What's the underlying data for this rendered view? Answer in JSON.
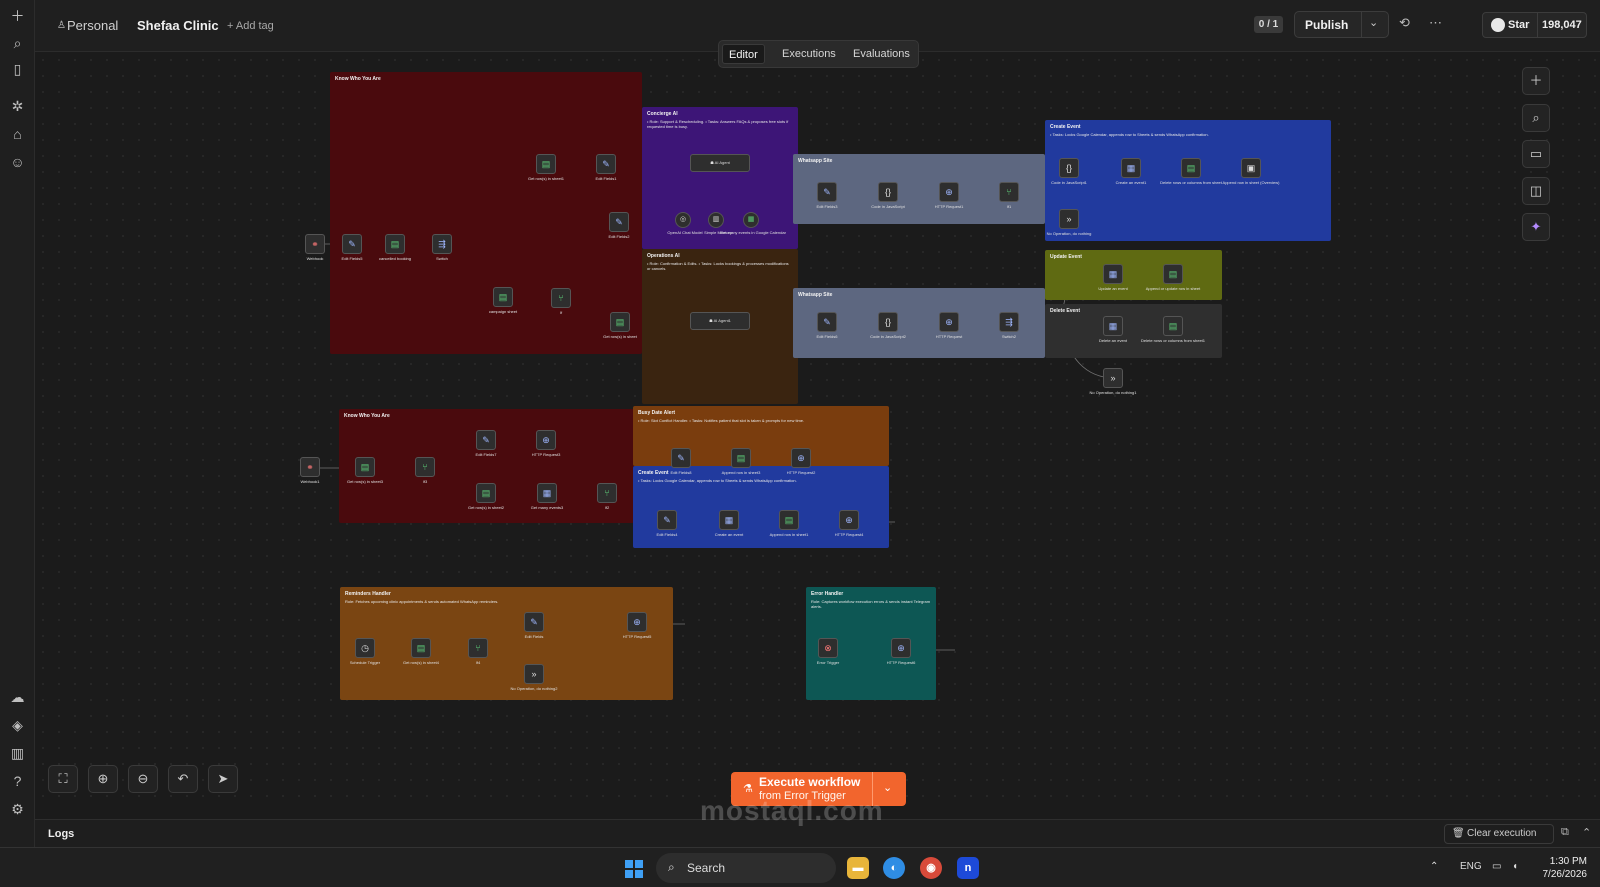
{
  "header": {
    "owner": "Personal",
    "workflow_name": "Shefaa Clinic",
    "add_tag": "+ Add tag",
    "version_counter": "0 / 1",
    "publish_label": "Publish",
    "star_label": "Star",
    "star_count": "198,047"
  },
  "tabs": [
    {
      "label": "Editor",
      "active": true
    },
    {
      "label": "Executions",
      "active": false
    },
    {
      "label": "Evaluations",
      "active": false
    }
  ],
  "sidebar_icons": [
    "plus-icon",
    "search-icon",
    "panel-icon",
    "templates-icon",
    "home-icon",
    "user-icon",
    "cloud-icon",
    "layers-icon",
    "chart-icon",
    "help-icon",
    "settings-icon"
  ],
  "stickies": [
    {
      "id": "know1",
      "title": "Know Who You Are",
      "text": "",
      "color": "#4a0a0d"
    },
    {
      "id": "concierge",
      "title": "Concierge AI",
      "text": "• Role: Support & Rescheduling. • Tasks: Answers FAQs & proposes free slots if requested time is busy.",
      "color": "#3d1577"
    },
    {
      "id": "operations",
      "title": "Operations AI",
      "text": "• Role: Confirmation & Edits. • Tasks: Locks bookings & processes modifications or cancels.",
      "color": "#3a2410"
    },
    {
      "id": "whatsapp1",
      "title": "Whatsapp Site",
      "text": "",
      "color": "#5d6780"
    },
    {
      "id": "whatsapp2",
      "title": "Whatsapp Site",
      "text": "",
      "color": "#5d6780"
    },
    {
      "id": "create1",
      "title": "Create Event",
      "text": "• Tasks: Locks Google Calendar, appends row to Sheets & sends WhatsApp confirmation.",
      "color": "#213a9e"
    },
    {
      "id": "update",
      "title": "Update Event",
      "text": "",
      "color": "#5f6a12"
    },
    {
      "id": "delete",
      "title": "Delete Event",
      "text": "",
      "color": "#2f2f2f"
    },
    {
      "id": "know2",
      "title": "Know Who You Are",
      "text": "",
      "color": "#4a0a0d"
    },
    {
      "id": "busy",
      "title": "Busy Date Alert",
      "text": "• Role: Slot Conflict Handler. • Tasks: Notifies patient that slot is taken & prompts for new time.",
      "color": "#7a3d0e"
    },
    {
      "id": "create2",
      "title": "Create Event",
      "text": "• Tasks: Locks Google Calendar, appends row to Sheets & sends WhatsApp confirmation.",
      "color": "#213a9e"
    },
    {
      "id": "reminders",
      "title": "Reminders Handler",
      "text": "Role: Fetches upcoming clinic appointments & sends automated WhatsApp reminders.",
      "color": "#7a4512"
    },
    {
      "id": "error",
      "title": "Error Handler",
      "text": "Role: Captures workflow execution errors & sends instant Telegram alerts.",
      "color": "#0d5754"
    }
  ],
  "nodes": [
    {
      "label": "Webhook",
      "icon": "webhook-icon",
      "kind": "r"
    },
    {
      "label": "Edit Fields5",
      "icon": "edit-icon",
      "kind": "b"
    },
    {
      "label": "cancelled booking",
      "icon": "sheet-icon",
      "kind": "g"
    },
    {
      "label": "Switch",
      "icon": "switch-icon",
      "kind": "b"
    },
    {
      "label": "Get row(s) in sheet1",
      "icon": "sheet-icon",
      "kind": "g"
    },
    {
      "label": "Edit Fields1",
      "icon": "edit-icon",
      "kind": "b"
    },
    {
      "label": "Edit Fields2",
      "icon": "edit-icon",
      "kind": "b"
    },
    {
      "label": "campaign sheet",
      "icon": "sheet-icon",
      "kind": "g"
    },
    {
      "label": "If",
      "icon": "if-icon",
      "kind": "g"
    },
    {
      "label": "Get row(s) in sheet",
      "icon": "sheet-icon",
      "kind": "g"
    },
    {
      "label": "AI Agent",
      "icon": "agent-icon",
      "kind": ""
    },
    {
      "label": "OpenAI Chat Model",
      "icon": "openai-icon",
      "kind": ""
    },
    {
      "label": "Simple Memory",
      "icon": "memory-icon",
      "kind": ""
    },
    {
      "label": "Get many events in Google Calendar",
      "icon": "calendar-icon",
      "kind": "g"
    },
    {
      "label": "AI Agent1",
      "icon": "agent-icon",
      "kind": ""
    },
    {
      "label": "Edit Fields3",
      "icon": "edit-icon",
      "kind": "b"
    },
    {
      "label": "Code in JavaScript",
      "icon": "code-icon",
      "kind": ""
    },
    {
      "label": "HTTP Request1",
      "icon": "http-icon",
      "kind": "b"
    },
    {
      "label": "If1",
      "icon": "if-icon",
      "kind": "g"
    },
    {
      "label": "Code in JavaScript1",
      "icon": "code-icon",
      "kind": ""
    },
    {
      "label": "Create an event1",
      "icon": "calendar-icon",
      "kind": "b"
    },
    {
      "label": "Delete rows or columns from sheet",
      "icon": "sheet-icon",
      "kind": "g"
    },
    {
      "label": "Append row in sheet (Overview)",
      "icon": "doc-icon",
      "kind": ""
    },
    {
      "label": "No Operation, do nothing",
      "icon": "noop-icon",
      "kind": ""
    },
    {
      "label": "Edit Fields6",
      "icon": "edit-icon",
      "kind": "b"
    },
    {
      "label": "Code in JavaScript2",
      "icon": "code-icon",
      "kind": ""
    },
    {
      "label": "HTTP Request",
      "icon": "http-icon",
      "kind": "b"
    },
    {
      "label": "Switch2",
      "icon": "switch-icon",
      "kind": "b"
    },
    {
      "label": "Update an event",
      "icon": "calendar-icon",
      "kind": "b"
    },
    {
      "label": "Append or update row in sheet",
      "icon": "sheet-icon",
      "kind": "g"
    },
    {
      "label": "Delete an event",
      "icon": "calendar-icon",
      "kind": "b"
    },
    {
      "label": "Delete rows or columns from sheet1",
      "icon": "sheet-icon",
      "kind": "g"
    },
    {
      "label": "No Operation, do nothing1",
      "icon": "noop-icon",
      "kind": ""
    },
    {
      "label": "Webhook1",
      "icon": "webhook-icon",
      "kind": "r"
    },
    {
      "label": "Get row(s) in sheet3",
      "icon": "sheet-icon",
      "kind": "g"
    },
    {
      "label": "If3",
      "icon": "if-icon",
      "kind": "g"
    },
    {
      "label": "Edit Fields7",
      "icon": "edit-icon",
      "kind": "b"
    },
    {
      "label": "HTTP Request3",
      "icon": "http-icon",
      "kind": "b"
    },
    {
      "label": "Get row(s) in sheet2",
      "icon": "sheet-icon",
      "kind": "g"
    },
    {
      "label": "Get many events3",
      "icon": "calendar-icon",
      "kind": "b"
    },
    {
      "label": "If2",
      "icon": "if-icon",
      "kind": "g"
    },
    {
      "label": "Edit Fields8",
      "icon": "edit-icon",
      "kind": "b"
    },
    {
      "label": "Append row in sheet3",
      "icon": "sheet-icon",
      "kind": "g"
    },
    {
      "label": "HTTP Request2",
      "icon": "http-icon",
      "kind": "b"
    },
    {
      "label": "Edit Fields4",
      "icon": "edit-icon",
      "kind": "b"
    },
    {
      "label": "Create an event",
      "icon": "calendar-icon",
      "kind": "b"
    },
    {
      "label": "Append row in sheet1",
      "icon": "sheet-icon",
      "kind": "g"
    },
    {
      "label": "HTTP Request4",
      "icon": "http-icon",
      "kind": "b"
    },
    {
      "label": "Schedule Trigger",
      "icon": "clock-icon",
      "kind": ""
    },
    {
      "label": "Get row(s) in sheet4",
      "icon": "sheet-icon",
      "kind": "g"
    },
    {
      "label": "If4",
      "icon": "if-icon",
      "kind": "g"
    },
    {
      "label": "Edit Fields",
      "icon": "edit-icon",
      "kind": "b"
    },
    {
      "label": "HTTP Request5",
      "icon": "http-icon",
      "kind": "b"
    },
    {
      "label": "No Operation, do nothing2",
      "icon": "noop-icon",
      "kind": ""
    },
    {
      "label": "Error Trigger",
      "icon": "error-icon",
      "kind": "r"
    },
    {
      "label": "HTTP Request6",
      "icon": "http-icon",
      "kind": "b"
    }
  ],
  "execute": {
    "line1": "Execute workflow",
    "line2": "from Error Trigger"
  },
  "logs": {
    "label": "Logs",
    "clear_label": "Clear execution"
  },
  "taskbar": {
    "search_label": "Search",
    "lang": "ENG",
    "time": "1:30 PM",
    "date": "7/26/2026",
    "app_n_letter": "n"
  },
  "watermark": "mostaql.com"
}
